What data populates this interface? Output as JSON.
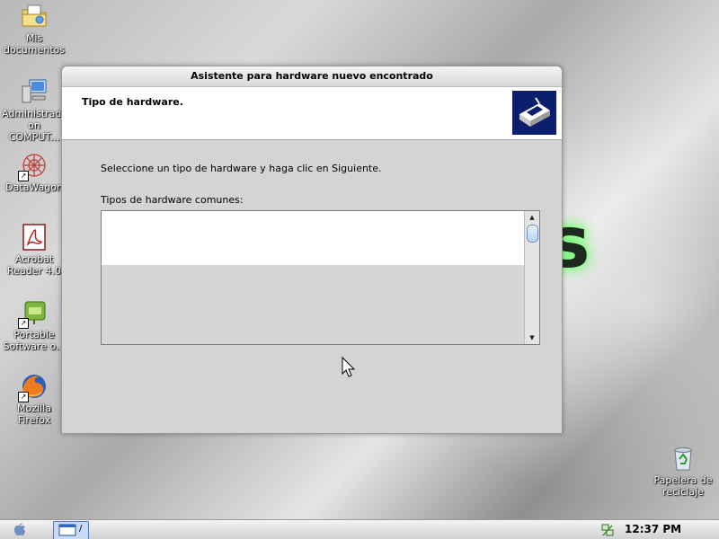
{
  "desktop": {
    "icons": [
      {
        "label": "Mis documentos",
        "icon": "folder-documents-icon"
      },
      {
        "label": "Administrado on COMPUT...",
        "icon": "computer-icon"
      },
      {
        "label": "DataWagon",
        "icon": "datawagon-icon"
      },
      {
        "label": "Acrobat Reader 4.0",
        "icon": "acrobat-reader-icon"
      },
      {
        "label": "Portable Software o...",
        "icon": "portable-software-icon"
      },
      {
        "label": "Mozilla Firefox",
        "icon": "firefox-icon"
      },
      {
        "label": "Papelera de reciclaje",
        "icon": "recycle-bin-icon"
      }
    ],
    "wallpaper_letter": "s"
  },
  "wizard": {
    "title": "Asistente para hardware nuevo encontrado",
    "header_title": "Tipo de hardware.",
    "instruction": "Seleccione un tipo de hardware y haga clic en Siguiente.",
    "list_label": "Tipos de hardware comunes:",
    "list_items": []
  },
  "taskbar": {
    "clock": "12:37 PM",
    "task_button_label": "/"
  },
  "colors": {
    "dialog_bg": "#d4d4d4",
    "header_icon_bg": "#0b1f6e",
    "taskbar_bg": "#dcdcdc"
  }
}
